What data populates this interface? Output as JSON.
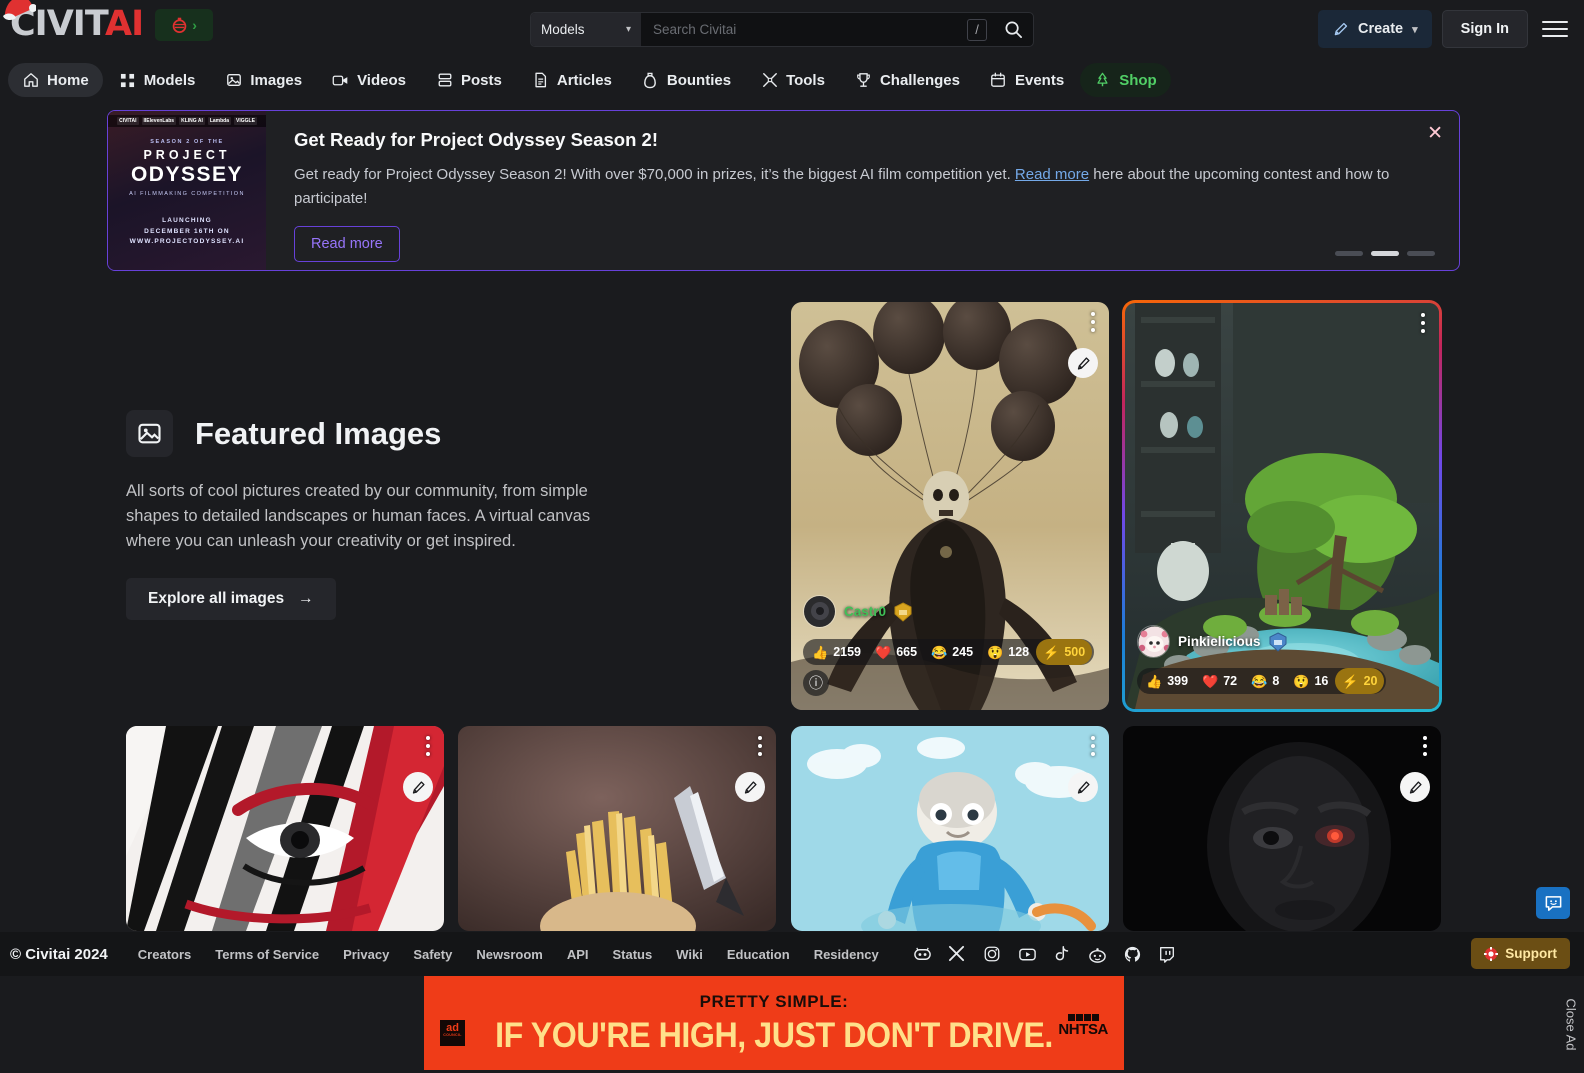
{
  "header": {
    "logo": {
      "civit": "CIVIT",
      "ai": "AI",
      "icon": "santa-hat-logo"
    },
    "holiday_badge": {
      "icon": "christmas-bauble-icon",
      "chevron": "›"
    },
    "search": {
      "category": "Models",
      "placeholder": "Search Civitai",
      "value": "",
      "shortcut": "/"
    },
    "create_label": "Create",
    "signin_label": "Sign In"
  },
  "nav": {
    "items": [
      {
        "label": "Home",
        "icon": "home-icon",
        "active": true
      },
      {
        "label": "Models",
        "icon": "grid-icon",
        "active": false
      },
      {
        "label": "Images",
        "icon": "image-icon",
        "active": false
      },
      {
        "label": "Videos",
        "icon": "video-icon",
        "active": false
      },
      {
        "label": "Posts",
        "icon": "posts-icon",
        "active": false
      },
      {
        "label": "Articles",
        "icon": "article-icon",
        "active": false
      },
      {
        "label": "Bounties",
        "icon": "bounty-icon",
        "active": false
      },
      {
        "label": "Tools",
        "icon": "tools-icon",
        "active": false
      },
      {
        "label": "Challenges",
        "icon": "trophy-icon",
        "active": false
      },
      {
        "label": "Events",
        "icon": "calendar-icon",
        "active": false
      },
      {
        "label": "Shop",
        "icon": "christmas-tree-icon",
        "active": false
      }
    ]
  },
  "announcement": {
    "title": "Get Ready for Project Odyssey Season 2!",
    "body_1": "Get ready for Project Odyssey Season 2! With over $70,000 in prizes, it’s the biggest AI film competition yet. ",
    "link": "Read more",
    "body_2": " here about the upcoming contest and how to participate!",
    "button_label": "Read more",
    "close_icon": "close-icon",
    "thumb": {
      "logos": [
        "CIVITAI",
        "IIElevenLabs",
        "KLING AI",
        "Lambda",
        "VIGGLE"
      ],
      "season": "SEASON 2 OF THE",
      "project": "PROJECT",
      "odyssey": "ODYSSEY",
      "subtitle": "AI FILMMAKING COMPETITION",
      "launch_line_1": "LAUNCHING",
      "launch_line_2": "DECEMBER 16TH ON",
      "launch_line_3": "WWW.PROJECTODYSSEY.AI"
    },
    "carousel": {
      "active_index": 1,
      "count": 3
    }
  },
  "featured": {
    "icon": "image-icon",
    "title": "Featured Images",
    "description": "All sorts of cool pictures created by our community, from simple shapes to detailed landscapes or human faces. A virtual canvas where you can unleash your creativity or get inspired.",
    "explore_label": "Explore all images",
    "explore_arrow": "→"
  },
  "cards": [
    {
      "id": "reaper-balloons",
      "user": "Castr0",
      "user_color": "#40c057",
      "has_badge": true,
      "has_info": true,
      "gradient_border": false,
      "reactions": [
        {
          "emoji": "👍",
          "count": "2159",
          "gold": false
        },
        {
          "emoji": "❤️",
          "count": "665",
          "gold": false
        },
        {
          "emoji": "😂",
          "count": "245",
          "gold": false
        },
        {
          "emoji": "😲",
          "count": "128",
          "gold": false
        },
        {
          "emoji": "⚡",
          "count": "500",
          "gold": true
        }
      ]
    },
    {
      "id": "bonsai-island",
      "user": "Pinkielicious",
      "user_color": "#ffffff",
      "has_badge": true,
      "has_info": false,
      "gradient_border": true,
      "reactions": [
        {
          "emoji": "👍",
          "count": "399",
          "gold": false
        },
        {
          "emoji": "❤️",
          "count": "72",
          "gold": false
        },
        {
          "emoji": "😂",
          "count": "8",
          "gold": false
        },
        {
          "emoji": "😲",
          "count": "16",
          "gold": false
        },
        {
          "emoji": "⚡",
          "count": "20",
          "gold": true
        }
      ]
    },
    {
      "id": "red-black-makeup",
      "user": "",
      "reactions": []
    },
    {
      "id": "fries-potato",
      "user": "",
      "reactions": []
    },
    {
      "id": "clay-robot",
      "user": "",
      "reactions": []
    },
    {
      "id": "dark-face",
      "user": "",
      "reactions": []
    }
  ],
  "footer": {
    "copyright": "© Civitai 2024",
    "links": [
      "Creators",
      "Terms of Service",
      "Privacy",
      "Safety",
      "Newsroom",
      "API",
      "Status",
      "Wiki",
      "Education",
      "Residency"
    ],
    "socials": [
      "discord-icon",
      "x-icon",
      "instagram-icon",
      "youtube-icon",
      "tiktok-icon",
      "reddit-icon",
      "github-icon",
      "twitch-icon"
    ],
    "support_label": "Support",
    "support_icon": "lifebuoy-icon"
  },
  "ad": {
    "headline": "PRETTY SIMPLE:",
    "main": "IF YOU'RE HIGH, JUST DON'T DRIVE.",
    "council_label": "ad",
    "council_sub": "COUNCIL",
    "sponsor": "NHTSA",
    "close_label": "Close Ad"
  },
  "chat_fab": {
    "icon": "chat-smiley-icon"
  }
}
